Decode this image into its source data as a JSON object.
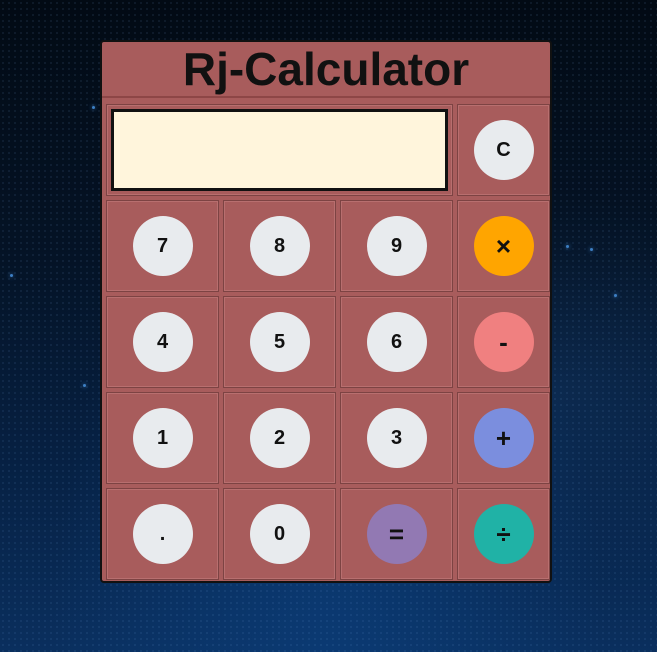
{
  "app": {
    "title": "Rj-Calculator"
  },
  "display": {
    "value": ""
  },
  "buttons": {
    "clear": "C",
    "seven": "7",
    "eight": "8",
    "nine": "9",
    "multiply": "×",
    "four": "4",
    "five": "5",
    "six": "6",
    "subtract": "-",
    "one": "1",
    "two": "2",
    "three": "3",
    "add": "+",
    "decimal": ".",
    "zero": "0",
    "equals": "=",
    "divide": "÷"
  },
  "colors": {
    "calculator_body": "#a85c5c",
    "display_bg": "#fff5dc",
    "digit_button": "#e8ebee",
    "multiply_button": "#ffa500",
    "subtract_button": "#f08080",
    "add_button": "#7b8ede",
    "equals_button": "#9279b3",
    "divide_button": "#20b2a6"
  }
}
